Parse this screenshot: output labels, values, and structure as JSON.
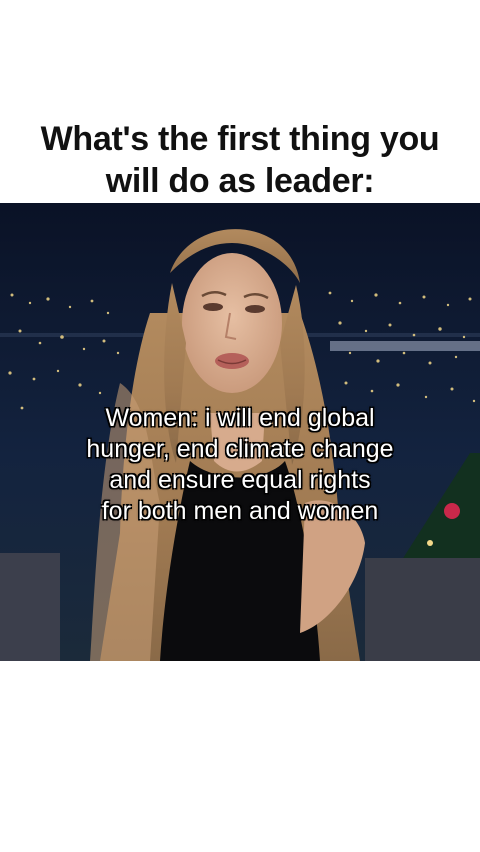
{
  "title": {
    "line1": "What's the first thing you",
    "line2": "will do as leader:"
  },
  "caption": {
    "line1": "Women: i will end global",
    "line2": "hunger, end climate change",
    "line3": "and ensure equal rights",
    "line4": "for both men and women"
  },
  "colors": {
    "background": "#ffffff",
    "title_text": "#111111",
    "caption_text": "#ffffff",
    "caption_outline": "#000000",
    "night_sky": "#0d1830"
  }
}
